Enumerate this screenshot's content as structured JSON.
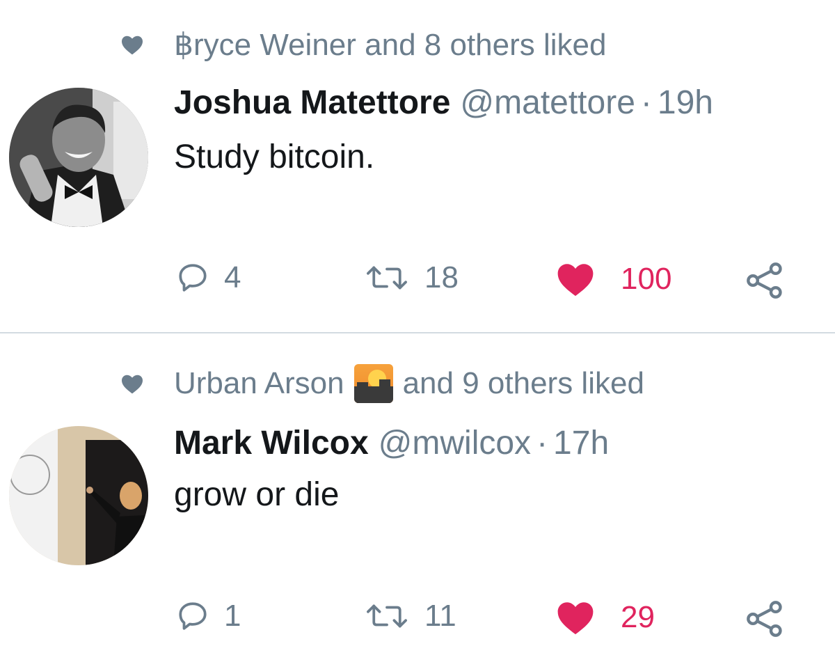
{
  "tweets": [
    {
      "social_context": "฿ryce Weiner and 8 others liked",
      "author_name": "Joshua Matettore",
      "handle": "@matettore",
      "separator": "·",
      "time": "19h",
      "text": "Study bitcoin.",
      "replies": "4",
      "retweets": "18",
      "likes": "100",
      "liked": true
    },
    {
      "social_context_prefix": "Urban Arson",
      "social_context_emoji": "city-sunset-emoji",
      "social_context_suffix": "and 9 others liked",
      "author_name": "Mark Wilcox",
      "handle": "@mwilcox",
      "separator": "·",
      "time": "17h",
      "text": "grow or die",
      "replies": "1",
      "retweets": "11",
      "likes": "29",
      "liked": true
    }
  ],
  "colors": {
    "muted": "#6b7d8c",
    "text": "#14171a",
    "like": "#e0245e",
    "divider": "#d3dbe1"
  }
}
